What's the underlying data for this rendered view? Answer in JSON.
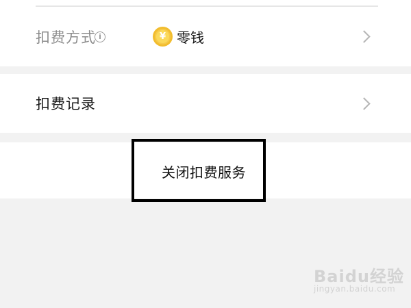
{
  "payment_method_row": {
    "label": "扣费方式",
    "info_glyph": "i",
    "coin_glyph": "¥",
    "value": "零钱"
  },
  "deduction_records_row": {
    "label": "扣费记录"
  },
  "close_service": {
    "label": "关闭扣费服务"
  },
  "watermark": {
    "main": "Baidu经验",
    "sub": "jingyan.baidu.com"
  },
  "colors": {
    "background": "#f2f2f2",
    "card": "#ffffff",
    "label_gray": "#8c8c8c",
    "label_dark": "#1a1a1a",
    "coin": "#f6c94a",
    "chevron": "#b5b5b5",
    "box_border": "#000000"
  }
}
